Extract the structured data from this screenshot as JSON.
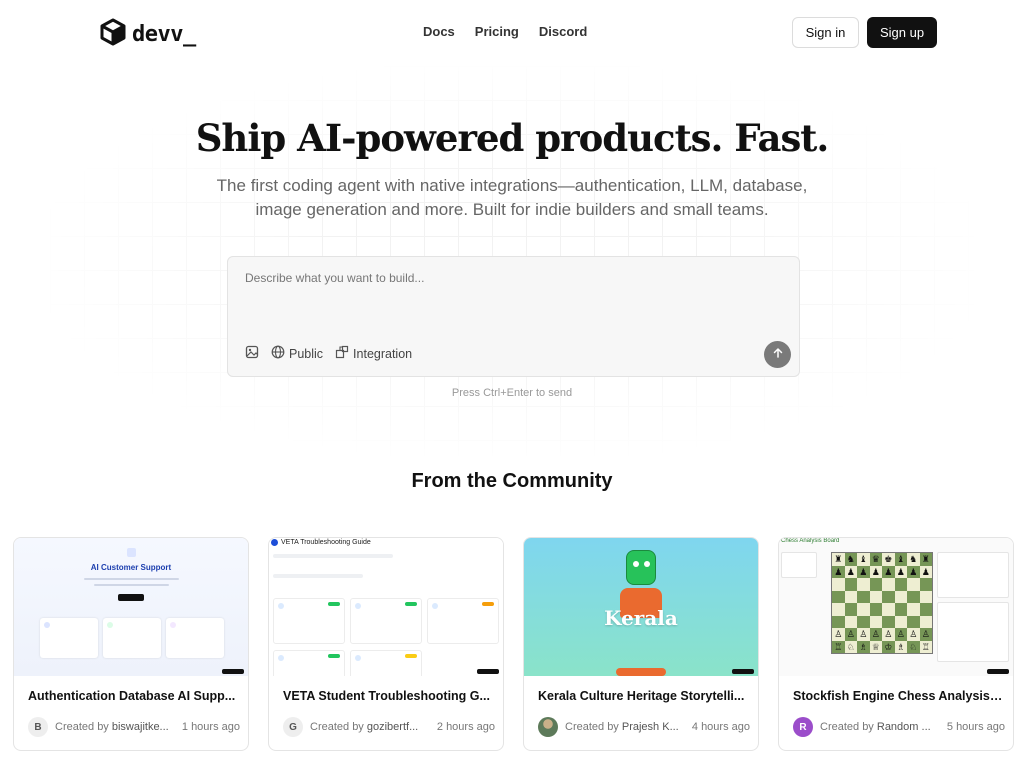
{
  "header": {
    "logo_text": "devv_",
    "nav": [
      "Docs",
      "Pricing",
      "Discord"
    ],
    "sign_in": "Sign in",
    "sign_up": "Sign up"
  },
  "hero": {
    "title": "Ship AI-powered products. Fast.",
    "subtitle": "The first coding agent with native integrations—authentication, LLM, database, image generation and more. Built for indie builders and small teams.",
    "prompt_placeholder": "Describe what you want to build...",
    "tools": {
      "public": "Public",
      "integration": "Integration"
    },
    "hint": "Press Ctrl+Enter to send"
  },
  "community": {
    "title": "From the Community",
    "created_by_prefix": "Created by",
    "cards": [
      {
        "title": "Authentication Database AI Supp...",
        "avatar": "B",
        "creator": "biswajitke...",
        "time": "1 hours ago",
        "thumb_heading": "AI Customer Support"
      },
      {
        "title": "VETA Student Troubleshooting G...",
        "avatar": "G",
        "creator": "gozibertf...",
        "time": "2 hours ago",
        "thumb_heading": "VETA Troubleshooting Guide"
      },
      {
        "title": "Kerala Culture Heritage Storytelli...",
        "avatar": "",
        "creator": "Prajesh K...",
        "time": "4 hours ago",
        "thumb_heading": "Kerala"
      },
      {
        "title": "Stockfish Engine Chess Analysis ...",
        "avatar": "R",
        "creator": "Random ...",
        "time": "5 hours ago",
        "thumb_heading": "Chess Analysis Board"
      }
    ]
  },
  "colors": {
    "primary": "#111111",
    "muted_text": "#666666",
    "send_button": "#7a7a7a",
    "avatar_r": "#9b4dca"
  },
  "icons": [
    "devv-cube-logo-icon",
    "image-upload-icon",
    "globe-icon",
    "integration-icon",
    "arrow-up-icon"
  ]
}
